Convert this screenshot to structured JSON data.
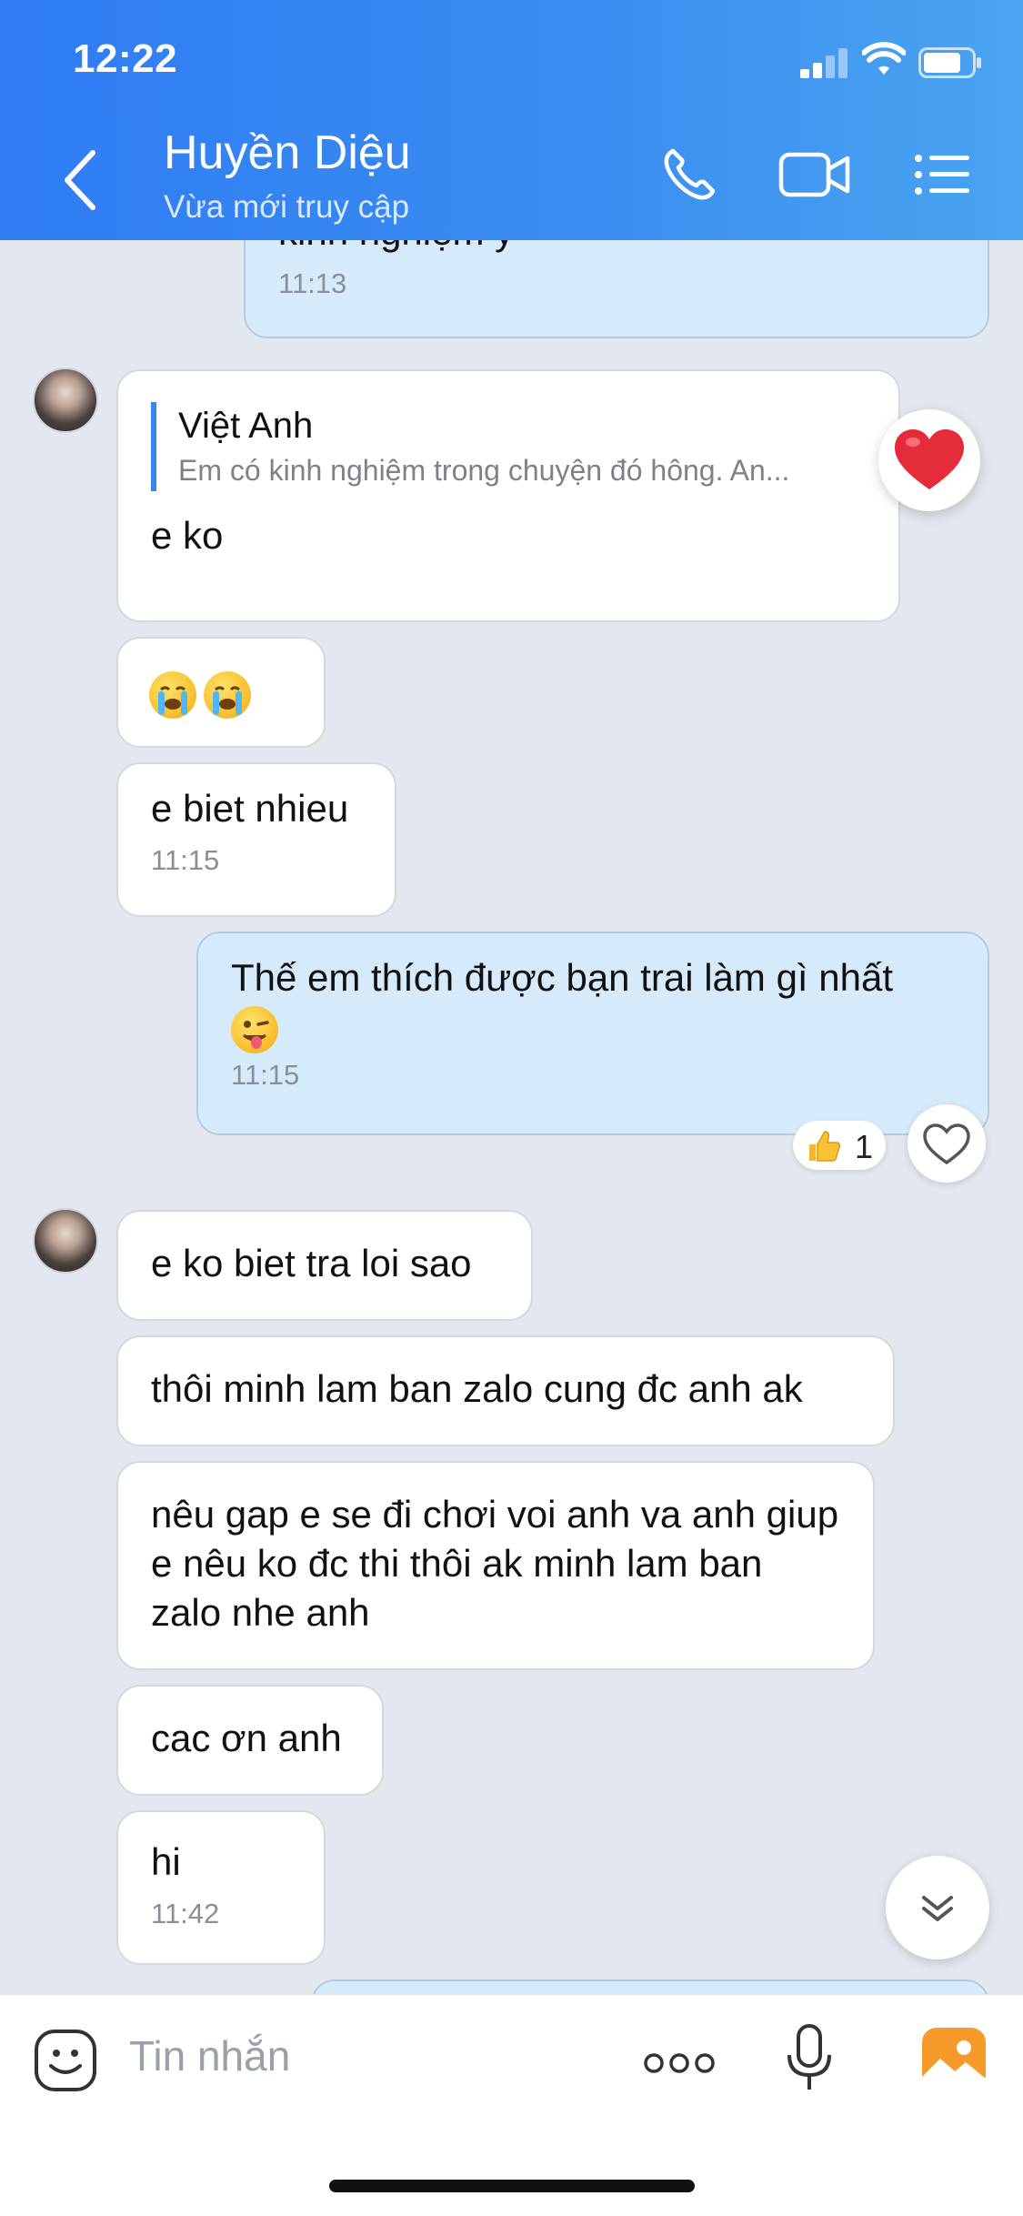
{
  "status_bar": {
    "time": "12:22"
  },
  "header": {
    "contact_name": "Huyền Diệu",
    "contact_status": "Vừa mới truy cập",
    "icons": [
      "back-icon",
      "phone-icon",
      "video-call-icon",
      "menu-list-icon"
    ]
  },
  "messages": {
    "m0": {
      "text_partial": "kinh nghiệm ý",
      "time": "11:13"
    },
    "m1": {
      "quote_name": "Việt Anh",
      "quote_text": "Em có kinh nghiệm trong chuyện đó hông. An...",
      "text": "e ko",
      "reaction": "heart"
    },
    "m2": {
      "emoji": "😭😭"
    },
    "m3": {
      "text": "e biet nhieu",
      "time": "11:15"
    },
    "m4": {
      "text": "Thế em thích được bạn trai làm gì nhất",
      "time": "11:15",
      "reaction_count": "1"
    },
    "m5": {
      "text": "e ko biet tra loi sao"
    },
    "m6": {
      "text": "thôi minh lam ban zalo cung đc anh ak"
    },
    "m7": {
      "text": "nêu gap e se đi chơi voi anh va anh giup e nêu ko đc thi thôi ak minh lam ban zalo nhe anh"
    },
    "m8": {
      "text": "cac ơn anh"
    },
    "m9": {
      "text": "hi",
      "time": "11:42"
    }
  },
  "input_bar": {
    "placeholder": "Tin nhắn"
  },
  "colors": {
    "header_start": "#2f7cf4",
    "header_end": "#4aa4f0",
    "chat_background": "#e3e7ef",
    "outgoing_bubble": "#d5ebfb",
    "incoming_bubble": "#ffffff",
    "quote_accent": "#3a86f0"
  }
}
